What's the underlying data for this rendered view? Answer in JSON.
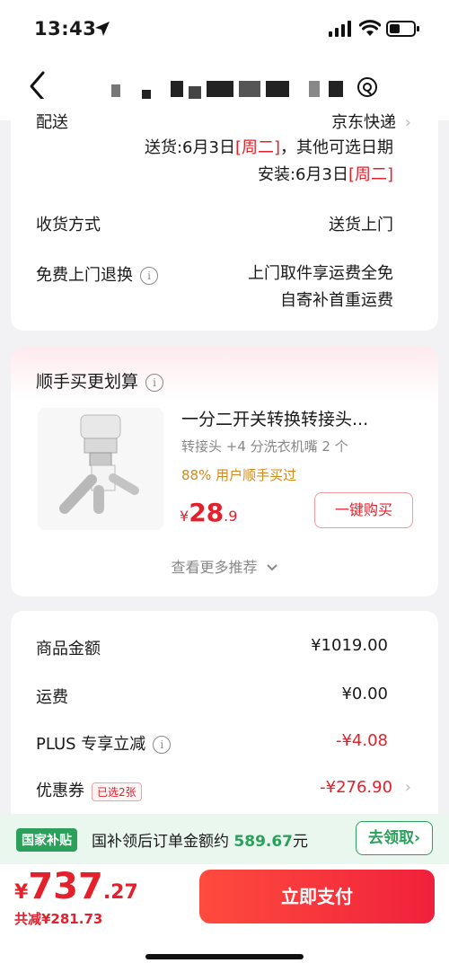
{
  "status": {
    "time": "13:43"
  },
  "delivery": {
    "label": "配送",
    "carrier": "京东快递",
    "send_line_prefix": "送货:6月3日",
    "send_day": "[周二]",
    "send_line_suffix": "，其他可选日期",
    "install_prefix": "安装:6月3日",
    "install_day": "[周二]",
    "receive_label": "收货方式",
    "receive_value": "送货上门",
    "return_label": "免费上门退换",
    "return_value_1": "上门取件享运费全免",
    "return_value_2": "自寄补首重运费"
  },
  "recommend": {
    "title": "顺手买更划算",
    "product_name": "一分二开关转换转接头...",
    "product_spec": "转接头 +4 分洗衣机嘴 2 个",
    "product_stat": "88% 用户顺手买过",
    "price_symbol": "¥",
    "price_int": "28",
    "price_dec": ".9",
    "buy_label": "一键购买",
    "more_label": "查看更多推荐",
    "product_image": "faucet-adapter-image"
  },
  "summary": {
    "goods_label": "商品金额",
    "goods_value": "¥1019.00",
    "ship_label": "运费",
    "ship_value": "¥0.00",
    "plus_label": "PLUS 专享立减",
    "plus_value": "-¥4.08",
    "coupon_label": "优惠券",
    "coupon_tag": "已选2张",
    "coupon_value": "-¥276.90"
  },
  "subsidy": {
    "badge": "国家补贴",
    "text_prefix": "国补领后订单金额约",
    "amount": "589.67",
    "unit": "元",
    "claim_label": "去领取"
  },
  "pay": {
    "symbol": "¥",
    "total_int": "737",
    "total_dec": ".27",
    "saved": "共减¥281.73",
    "button": "立即支付"
  },
  "colors": {
    "accent": "#e3202b",
    "green": "#2aa05a",
    "gold": "#d08a1e"
  }
}
